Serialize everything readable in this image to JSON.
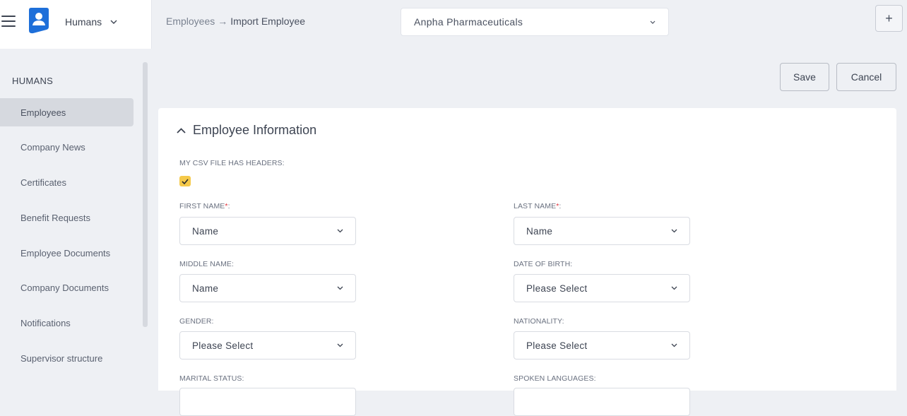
{
  "app": {
    "name": "Humans"
  },
  "breadcrumb": {
    "parent": "Employees",
    "separator": "→",
    "current": "Import Employee"
  },
  "company_select": {
    "value": "Anpha Pharmaceuticals"
  },
  "header": {
    "add_label": "+"
  },
  "sidebar": {
    "heading": "HUMANS",
    "items": [
      {
        "label": "Employees",
        "active": true
      },
      {
        "label": "Company News"
      },
      {
        "label": "Certificates"
      },
      {
        "label": "Benefit Requests"
      },
      {
        "label": "Employee Documents"
      },
      {
        "label": "Company Documents"
      },
      {
        "label": "Notifications"
      },
      {
        "label": "Supervisor structure"
      }
    ]
  },
  "actions": {
    "save": "Save",
    "cancel": "Cancel"
  },
  "card": {
    "title": "Employee Information",
    "csv_headers_label": "MY CSV FILE HAS HEADERS:",
    "csv_headers_checked": true,
    "fields": {
      "first_name": {
        "label": "FIRST NAME",
        "required_mark": "*",
        "suffix": ":",
        "value": "Name"
      },
      "last_name": {
        "label": "LAST NAME",
        "required_mark": "*",
        "suffix": ":",
        "value": "Name"
      },
      "middle_name": {
        "label": "MIDDLE NAME:",
        "value": "Name"
      },
      "date_of_birth": {
        "label": "DATE OF BIRTH:",
        "value": "Please Select"
      },
      "gender": {
        "label": "GENDER:",
        "value": "Please Select"
      },
      "nationality": {
        "label": "NATIONALITY:",
        "value": "Please Select"
      },
      "marital_status": {
        "label": "MARITAL STATUS:"
      },
      "spoken_languages": {
        "label": "SPOKEN LANGUAGES:"
      }
    }
  },
  "colors": {
    "accent_checkbox": "#f5c94a",
    "required": "#e0313a",
    "logo": "#1e6fd9"
  }
}
